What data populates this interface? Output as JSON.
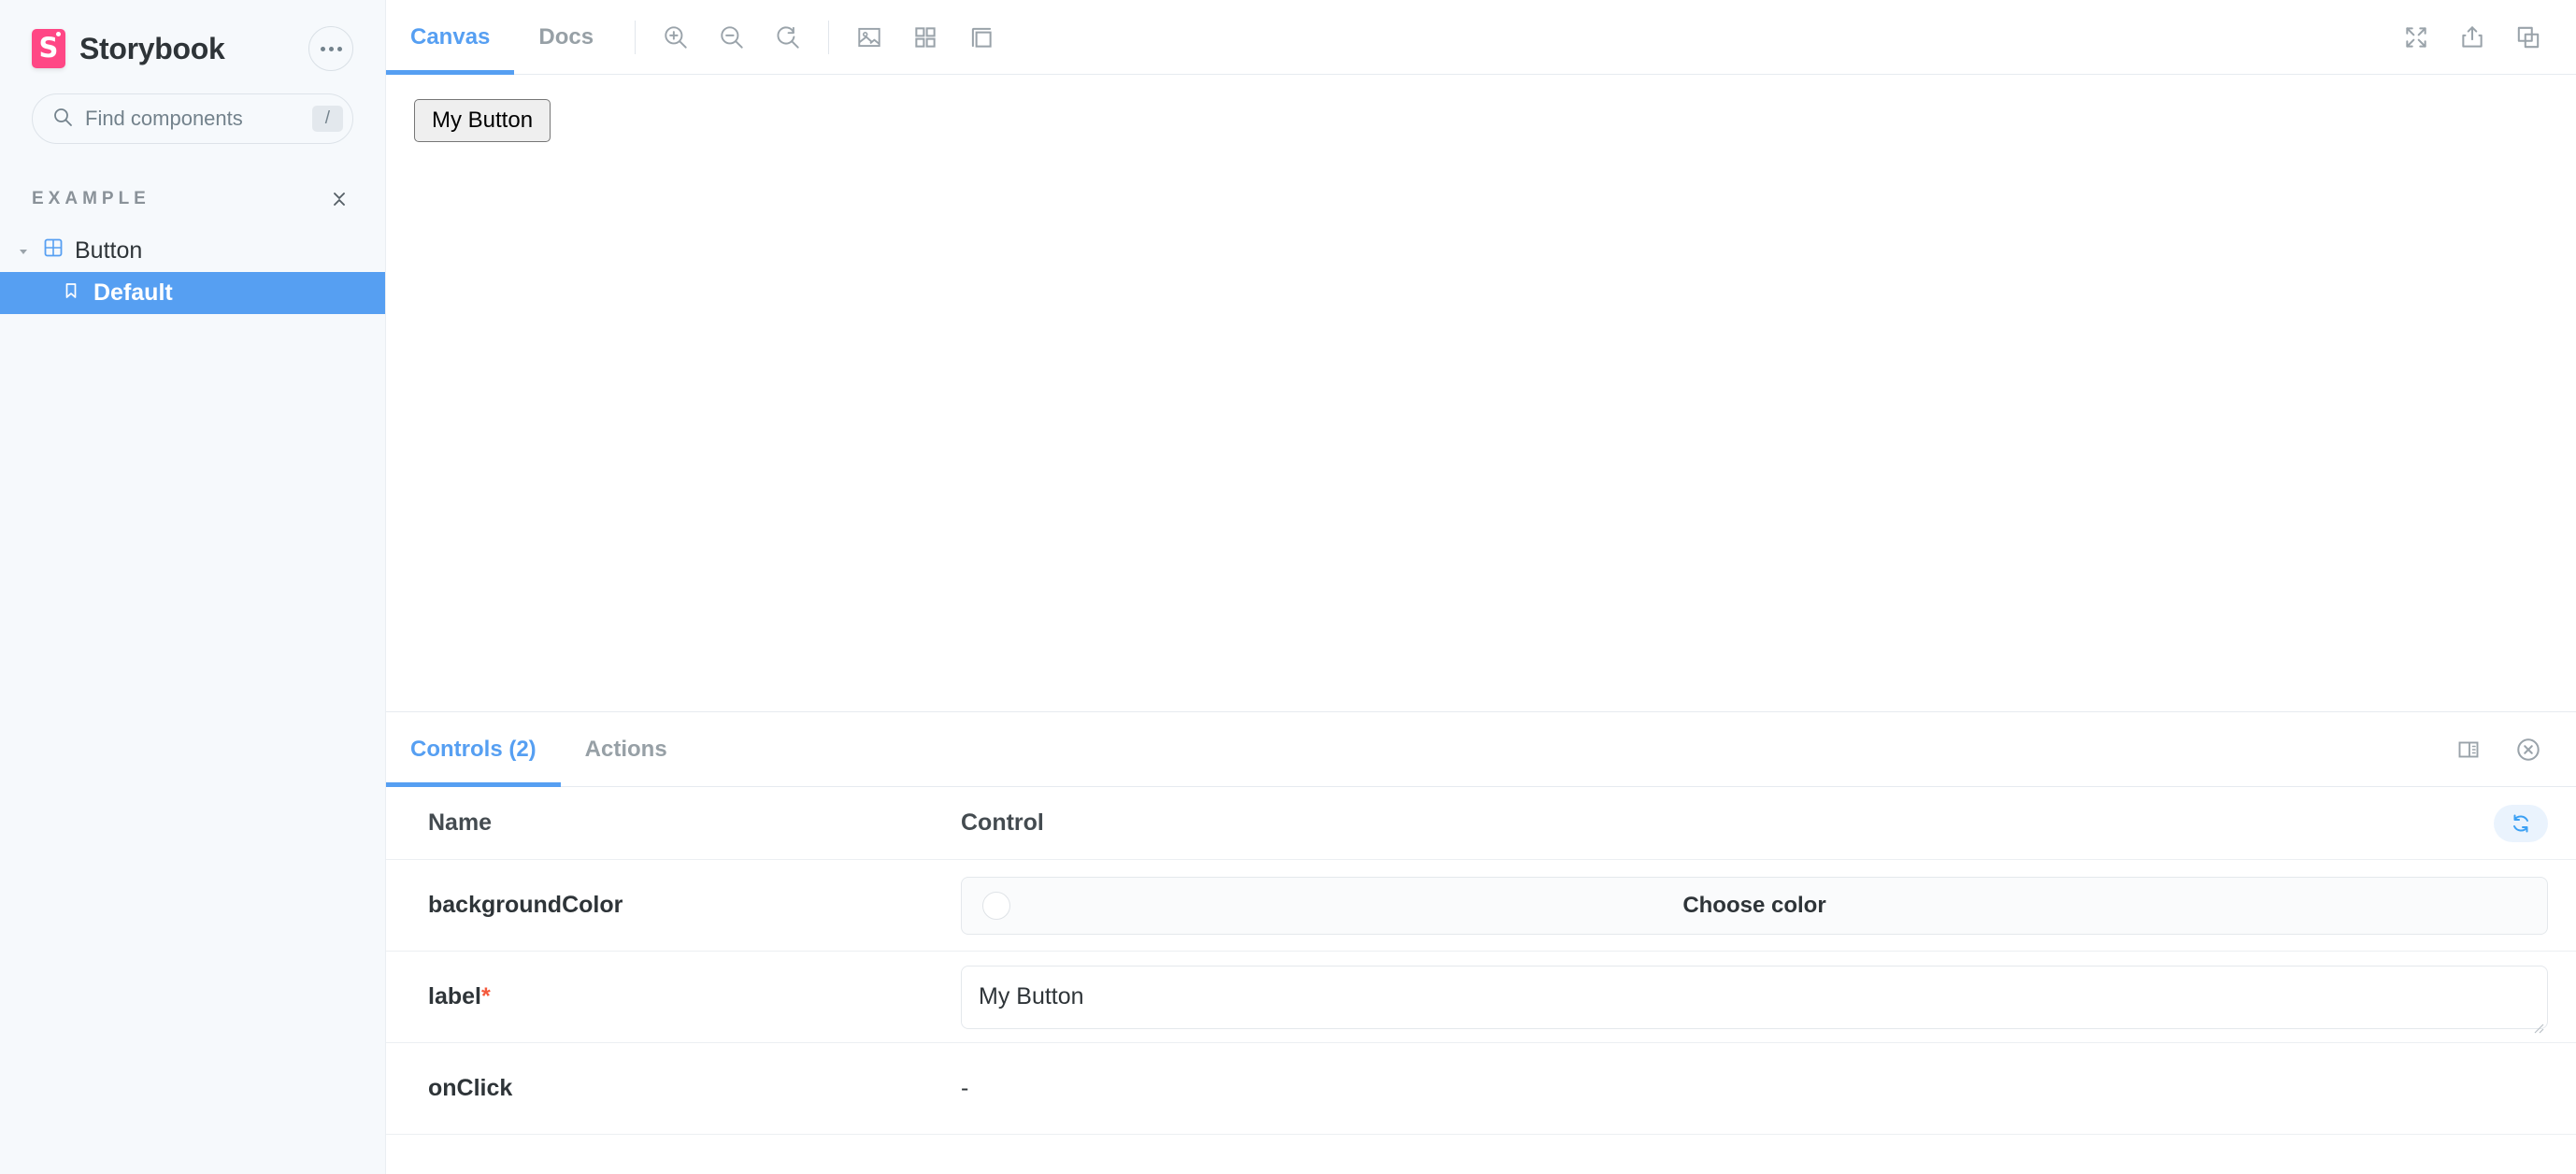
{
  "sidebar": {
    "brand": "Storybook",
    "menu_button": "menu-dots",
    "search": {
      "placeholder": "Find components",
      "shortcut": "/"
    },
    "section": {
      "title": "EXAMPLE",
      "collapse_label": "collapse-all"
    },
    "tree": [
      {
        "label": "Button",
        "type": "component",
        "expanded": true
      },
      {
        "label": "Default",
        "type": "story",
        "selected": true
      }
    ]
  },
  "toolbar": {
    "tabs": [
      {
        "label": "Canvas",
        "active": true
      },
      {
        "label": "Docs",
        "active": false
      }
    ],
    "zoom_in": "zoom-in",
    "zoom_out": "zoom-out",
    "zoom_reset": "zoom-reset",
    "backgrounds": "backgrounds",
    "grid": "grid",
    "measure": "measure",
    "fullscreen": "fullscreen",
    "share": "share",
    "copy": "copy"
  },
  "canvas": {
    "preview_button_label": "My Button"
  },
  "panel": {
    "tabs": [
      {
        "label": "Controls (2)",
        "active": true
      },
      {
        "label": "Actions",
        "active": false
      }
    ],
    "layout_toggle": "panel-position",
    "close": "close",
    "table": {
      "headers": {
        "name": "Name",
        "control": "Control"
      },
      "reset_label": "reset-controls",
      "rows": [
        {
          "name": "backgroundColor",
          "required": false,
          "control_type": "color",
          "placeholder": "Choose color",
          "value": ""
        },
        {
          "name": "label",
          "required": true,
          "required_mark": "*",
          "control_type": "text",
          "value": "My Button"
        },
        {
          "name": "onClick",
          "required": false,
          "control_type": "none",
          "value": "-"
        }
      ]
    }
  },
  "colors": {
    "accent": "#569ff2",
    "brand": "#ff4785",
    "required": "#f4593c",
    "sidebar_bg": "#f6f9fc"
  }
}
